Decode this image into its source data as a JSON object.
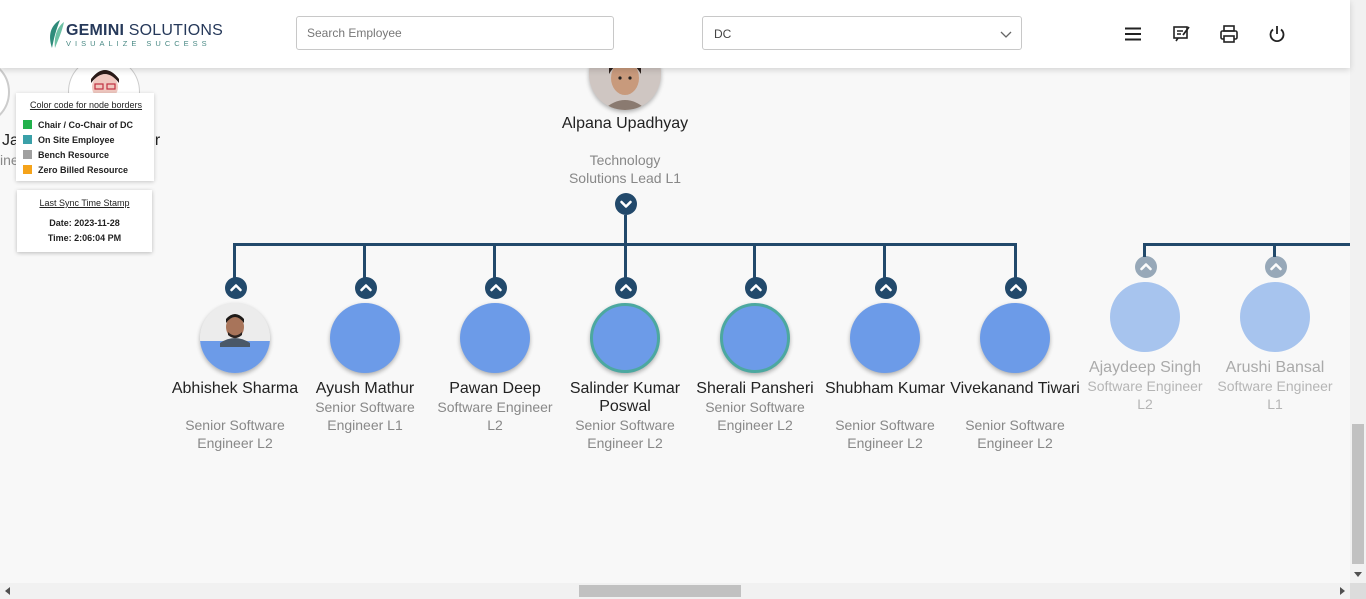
{
  "header": {
    "logo_brand": "GEMINI",
    "logo_suffix": " SOLUTIONS",
    "logo_tagline": "VISUALIZE SUCCESS",
    "search_placeholder": "Search Employee",
    "dept_select_value": "DC",
    "icons": [
      "menu-icon",
      "feedback-icon",
      "print-icon",
      "power-icon"
    ]
  },
  "parent": {
    "name": "Alpana Upadhyay",
    "role": "Technology Solutions Lead L1"
  },
  "partial_left": {
    "name_fragment_1": "Ja",
    "role_fragment_1": "ine",
    "name_fragment_2": "ur"
  },
  "children": [
    {
      "name": "Abhishek Sharma",
      "role": "Senior Software Engineer L2",
      "border": "none",
      "photo": true
    },
    {
      "name": "Ayush Mathur",
      "role": "Senior Software Engineer L1",
      "border": "none",
      "photo": false
    },
    {
      "name": "Pawan Deep",
      "role": "Software Engineer L2",
      "border": "none",
      "photo": false
    },
    {
      "name": "Salinder Kumar Poswal",
      "role": "Senior Software Engineer L2",
      "border": "on-site",
      "photo": false
    },
    {
      "name": "Sherali Pansheri",
      "role": "Senior Software Engineer L2",
      "border": "on-site",
      "photo": false
    },
    {
      "name": "Shubham Kumar",
      "role": "Senior Software Engineer L2",
      "border": "none",
      "photo": false
    },
    {
      "name": "Vivekanand Tiwari",
      "role": "Senior Software Engineer L2",
      "border": "none",
      "photo": false
    }
  ],
  "faded_children": [
    {
      "name": "Ajaydeep Singh",
      "role": "Software Engineer L2"
    },
    {
      "name": "Arushi Bansal",
      "role": "Software Engineer L1"
    }
  ],
  "legend": {
    "title": "Color code for node borders",
    "items": [
      {
        "label": "Chair / Co-Chair of DC",
        "color": "#22b14c"
      },
      {
        "label": "On Site Employee",
        "color": "#3aa0a8"
      },
      {
        "label": "Bench Resource",
        "color": "#a0a0a0"
      },
      {
        "label": "Zero Billed Resource",
        "color": "#f5a31a"
      }
    ]
  },
  "sync": {
    "title": "Last Sync Time Stamp",
    "date": "Date: 2023-11-28",
    "time": "Time: 2:06:04 PM"
  },
  "colors": {
    "connector": "#22496b",
    "avatar_fill": "#6c9be8",
    "onsite_border": "#4ca8a0"
  }
}
